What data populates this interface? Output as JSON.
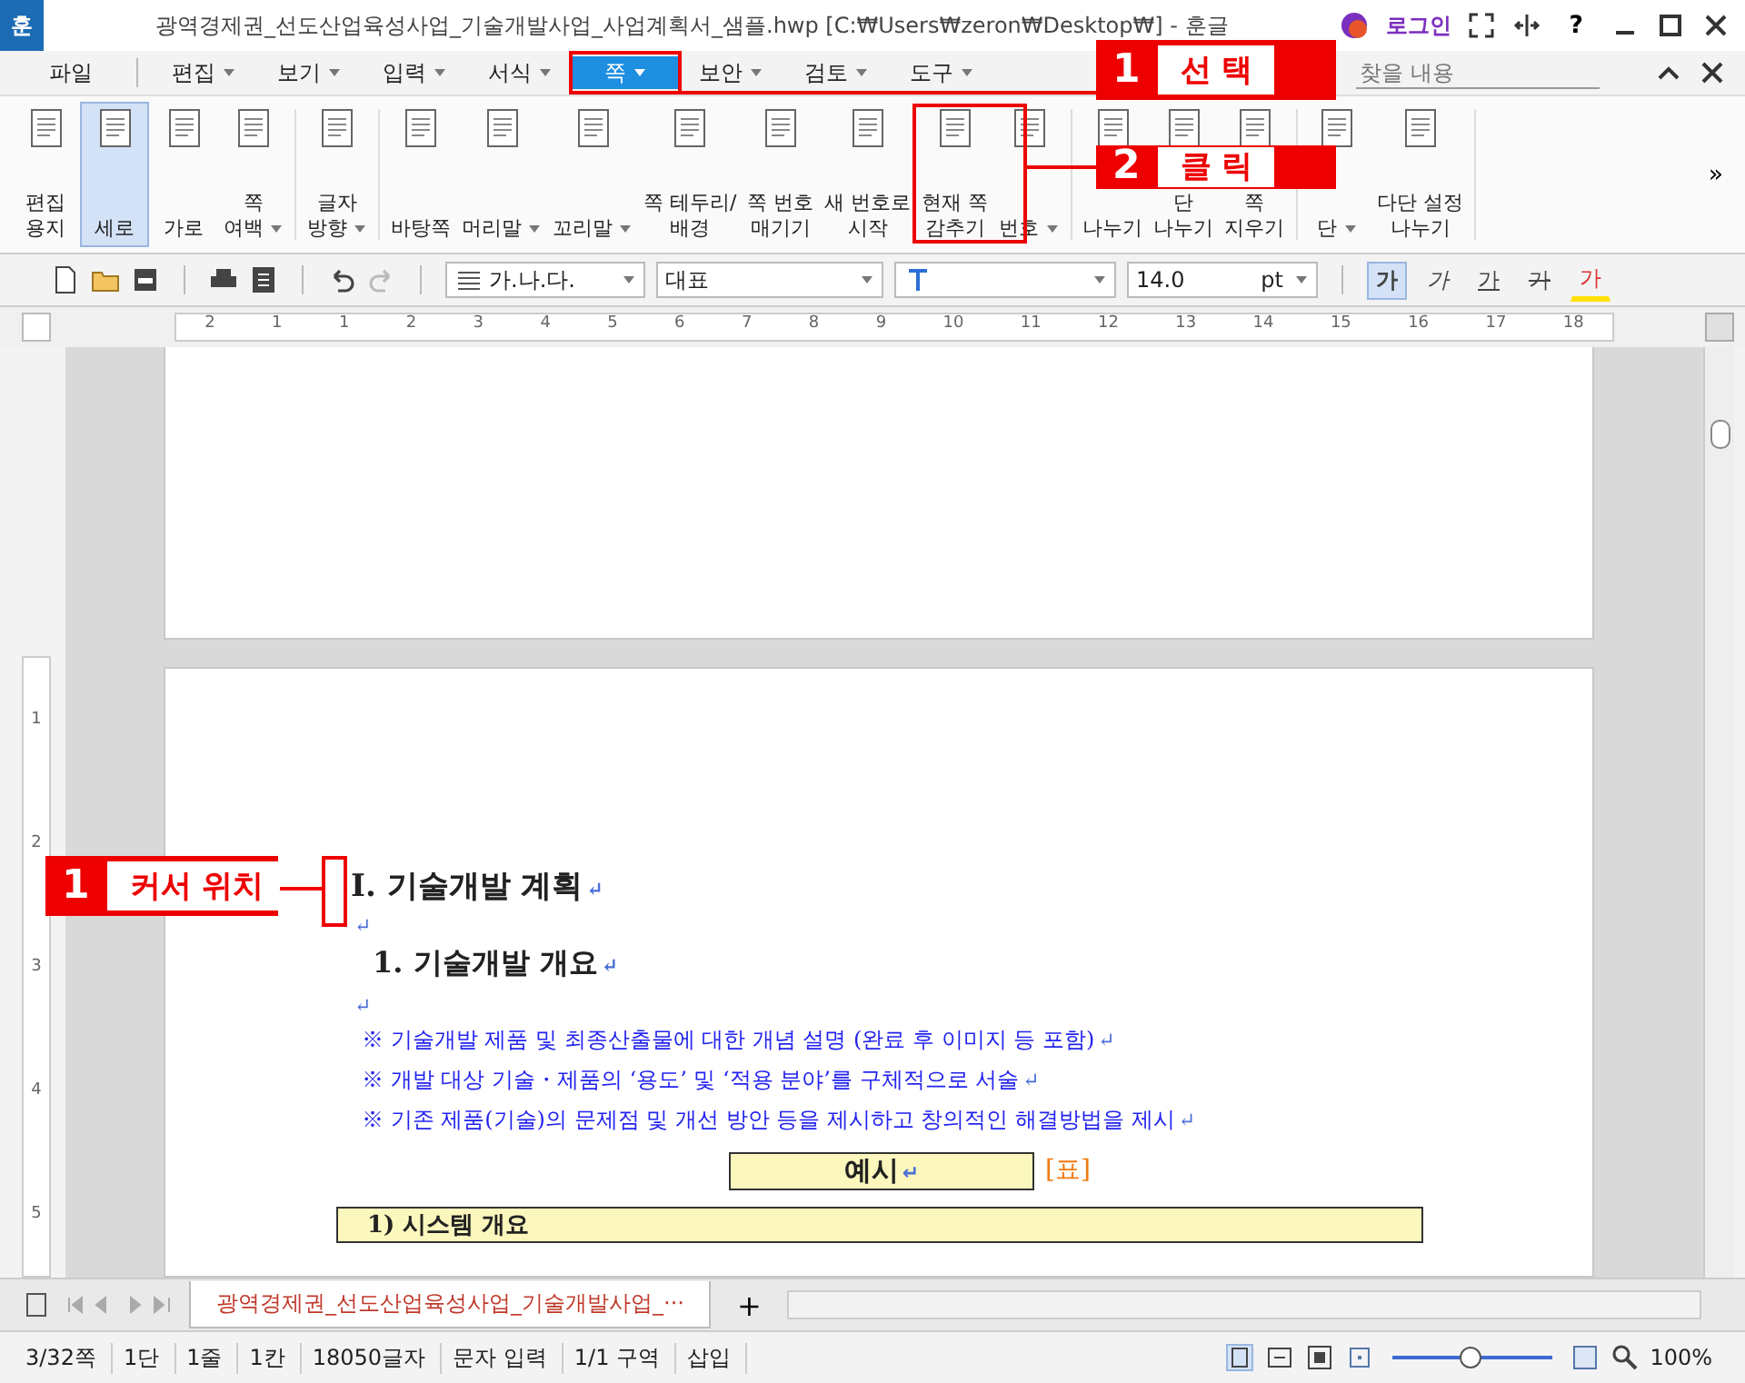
{
  "window": {
    "app_badge": "훈",
    "title": "광역경제권_선도산업육성사업_기술개발사업_사업계획서_샘플.hwp [C:₩Users₩zeron₩Desktop₩] - 훈글",
    "login": "로그인",
    "help": "?"
  },
  "menu": {
    "items": [
      {
        "label": "파일",
        "selected": false,
        "caret": false
      },
      {
        "label": "편집",
        "selected": false,
        "caret": true
      },
      {
        "label": "보기",
        "selected": false,
        "caret": true
      },
      {
        "label": "입력",
        "selected": false,
        "caret": true
      },
      {
        "label": "서식",
        "selected": false,
        "caret": true
      },
      {
        "label": "쪽",
        "selected": true,
        "caret": true
      },
      {
        "label": "보안",
        "selected": false,
        "caret": true
      },
      {
        "label": "검토",
        "selected": false,
        "caret": true
      },
      {
        "label": "도구",
        "selected": false,
        "caret": true
      }
    ],
    "search": {
      "placeholder": "찾을 내용"
    }
  },
  "ribbon": {
    "groups": [
      [
        {
          "lines": [
            "편집",
            "용지"
          ],
          "selected": false,
          "caret": false
        },
        {
          "lines": [
            "세로"
          ],
          "selected": true,
          "caret": false
        },
        {
          "lines": [
            "가로"
          ],
          "selected": false,
          "caret": false
        },
        {
          "lines": [
            "쪽",
            "여백"
          ],
          "selected": false,
          "caret": true
        }
      ],
      [
        {
          "lines": [
            "글자",
            "방향"
          ],
          "selected": false,
          "caret": true
        }
      ],
      [
        {
          "lines": [
            "바탕쪽"
          ],
          "selected": false,
          "caret": false
        },
        {
          "lines": [
            "머리말"
          ],
          "selected": false,
          "caret": true
        },
        {
          "lines": [
            "꼬리말"
          ],
          "selected": false,
          "caret": true
        },
        {
          "lines": [
            "쪽 테두리/",
            "배경"
          ],
          "selected": false,
          "caret": false
        },
        {
          "lines": [
            "쪽 번호",
            "매기기"
          ],
          "selected": false,
          "caret": false
        },
        {
          "lines": [
            "새 번호로",
            "시작"
          ],
          "selected": false,
          "caret": false
        },
        {
          "lines": [
            "현재 쪽",
            "감추기"
          ],
          "selected": false,
          "caret": false
        },
        {
          "lines": [
            "번호"
          ],
          "selected": false,
          "caret": true
        }
      ],
      [
        {
          "lines": [
            "나누기"
          ],
          "selected": false,
          "caret": false
        },
        {
          "lines": [
            "단",
            "나누기"
          ],
          "selected": false,
          "caret": false
        },
        {
          "lines": [
            "쪽",
            "지우기"
          ],
          "selected": false,
          "caret": false
        }
      ],
      [
        {
          "lines": [
            "단"
          ],
          "selected": false,
          "caret": true
        },
        {
          "lines": [
            "다단 설정",
            "나누기"
          ],
          "selected": false,
          "caret": false
        }
      ]
    ],
    "more": "»"
  },
  "toolbar": {
    "style": "가.나.다.",
    "font": "대표",
    "size": "14.0",
    "unit": "pt",
    "formats": [
      {
        "label": "가",
        "kind": "bold",
        "selected": true
      },
      {
        "label": "가",
        "kind": "italic",
        "selected": false
      },
      {
        "label": "가",
        "kind": "underline",
        "selected": false
      },
      {
        "label": "가",
        "kind": "strike",
        "selected": false
      },
      {
        "label": "가",
        "kind": "color",
        "selected": false
      }
    ]
  },
  "ruler": {
    "numbers": [
      "2",
      "1",
      "1",
      "2",
      "3",
      "4",
      "5",
      "6",
      "7",
      "8",
      "9",
      "10",
      "11",
      "12",
      "13",
      "14",
      "15",
      "16",
      "17",
      "18"
    ],
    "vertical": [
      "1",
      "2",
      "3",
      "4",
      "5"
    ]
  },
  "document": {
    "paragraphs": [
      {
        "kind": "heading1",
        "text": "Ⅰ. 기술개발 계획",
        "mark": "↵"
      },
      {
        "kind": "blank",
        "mark": "↵"
      },
      {
        "kind": "heading2",
        "text": "1. 기술개발 개요",
        "mark": "↵"
      },
      {
        "kind": "blank",
        "mark": "↵"
      },
      {
        "kind": "note",
        "text": "※ 기술개발 제품 및 최종산출물에 대한 개념 설명 (완료 후 이미지 등 포함)",
        "mark": "↵"
      },
      {
        "kind": "note",
        "text": "※ 개발 대상 기술・제품의 ‘용도’ 및 ‘적용 분야’를 구체적으로 서술",
        "mark": "↵"
      },
      {
        "kind": "note",
        "text": "※ 기존 제품(기술)의 문제점 및 개선 방안 등을 제시하고 창의적인 해결방법을 제시",
        "mark": "↵"
      },
      {
        "kind": "example",
        "text": "예시",
        "mark": "↵",
        "tag": "[표]"
      },
      {
        "kind": "box",
        "text": "1) 시스템 개요"
      }
    ]
  },
  "tabs": {
    "items": [
      {
        "label": "광역경제권_선도산업육성사업_기술개발사업_···",
        "selected": true
      }
    ],
    "add": "+"
  },
  "status_bar": {
    "items": [
      "3/32쪽",
      "1단",
      "1줄",
      "1칸",
      "18050글자",
      "문자 입력",
      "1/1 구역",
      "삽입"
    ],
    "zoom": {
      "level": 0.48,
      "reading": "100%"
    }
  },
  "annotations": [
    {
      "number": "1",
      "label": "선 택"
    },
    {
      "number": "2",
      "label": "클 릭"
    },
    {
      "number": "1",
      "label": "커서 위치"
    }
  ]
}
